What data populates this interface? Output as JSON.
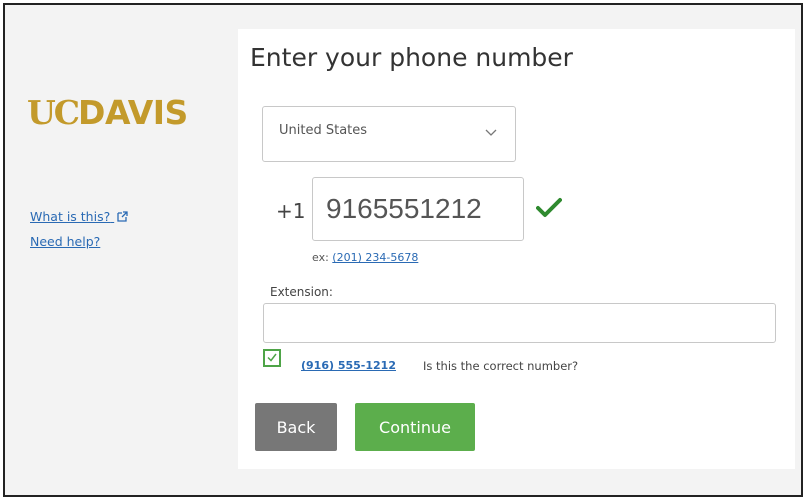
{
  "sidebar": {
    "logo": {
      "uc": "UC",
      "davis": "DAVIS"
    },
    "what_is_this": "What is this?",
    "need_help": "Need help?"
  },
  "form": {
    "title": "Enter your phone number",
    "country": "United States",
    "dial_code": "+1",
    "phone_value": "9165551212",
    "example_prefix": "ex:",
    "example_number": "(201) 234-5678",
    "extension_label": "Extension:",
    "extension_value": "",
    "confirm_number": "(916) 555-1212",
    "confirm_question": "Is this the correct number?",
    "confirm_checked": true,
    "back_label": "Back",
    "continue_label": "Continue"
  },
  "colors": {
    "brand_gold": "#c39a2b",
    "link_blue": "#2a6ab4",
    "success_green": "#4ea447",
    "continue_green": "#5cae4c",
    "back_gray": "#777777"
  },
  "icons": {
    "external_link": "external-link-icon",
    "dropdown": "chevron-down-icon",
    "valid": "checkmark-icon",
    "checkbox": "checkbox-checked-icon"
  }
}
